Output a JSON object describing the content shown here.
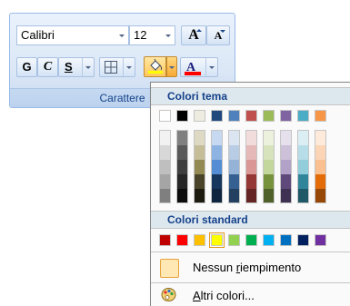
{
  "ribbon": {
    "font_name": "Calibri",
    "font_size": "12",
    "grow_label": "A",
    "shrink_label": "A",
    "bold_label": "G",
    "italic_label": "C",
    "underline_label": "S",
    "fontcolor_label": "A",
    "group_label": "Carattere",
    "colors": {
      "fill_highlight": "#ffff00",
      "font_color_bar": "#ff0000"
    }
  },
  "menu": {
    "theme_header": "Colori tema",
    "standard_header": "Colori standard",
    "theme_colors": [
      "#ffffff",
      "#000000",
      "#eeece1",
      "#1f497d",
      "#4f81bd",
      "#c0504d",
      "#9bbb59",
      "#8064a2",
      "#4bacc6",
      "#f79646"
    ],
    "theme_shades": [
      [
        "#f2f2f2",
        "#d8d8d8",
        "#bfbfbf",
        "#a5a5a5",
        "#7f7f7f"
      ],
      [
        "#7f7f7f",
        "#595959",
        "#3f3f3f",
        "#262626",
        "#0c0c0c"
      ],
      [
        "#ddd9c3",
        "#c4bd97",
        "#938953",
        "#494429",
        "#1d1b10"
      ],
      [
        "#c6d9f0",
        "#8db3e2",
        "#548dd4",
        "#17365d",
        "#0f243e"
      ],
      [
        "#dbe5f1",
        "#b8cce4",
        "#95b3d7",
        "#366092",
        "#244061"
      ],
      [
        "#f2dcdb",
        "#e5b9b7",
        "#d99694",
        "#953734",
        "#632423"
      ],
      [
        "#ebf1dd",
        "#d7e3bc",
        "#c3d69b",
        "#76923c",
        "#4f6128"
      ],
      [
        "#e5e0ec",
        "#ccc1d9",
        "#b2a2c7",
        "#5f497a",
        "#3f3151"
      ],
      [
        "#dbeef3",
        "#b7dde8",
        "#92cddc",
        "#31859b",
        "#205867"
      ],
      [
        "#fdeada",
        "#fbd5b5",
        "#fac08f",
        "#e36c09",
        "#974806"
      ]
    ],
    "standard_colors": [
      "#c00000",
      "#ff0000",
      "#ffc000",
      "#ffff00",
      "#92d050",
      "#00b050",
      "#00b0f0",
      "#0070c0",
      "#002060",
      "#7030a0"
    ],
    "selected_standard_index": 3,
    "no_fill_label_before": "Nessun ",
    "no_fill_label_ul": "r",
    "no_fill_label_after": "iempimento",
    "more_colors_label_ul": "A",
    "more_colors_label_after": "ltri colori...",
    "no_fill_swatch_color": "#ffe8b4"
  }
}
